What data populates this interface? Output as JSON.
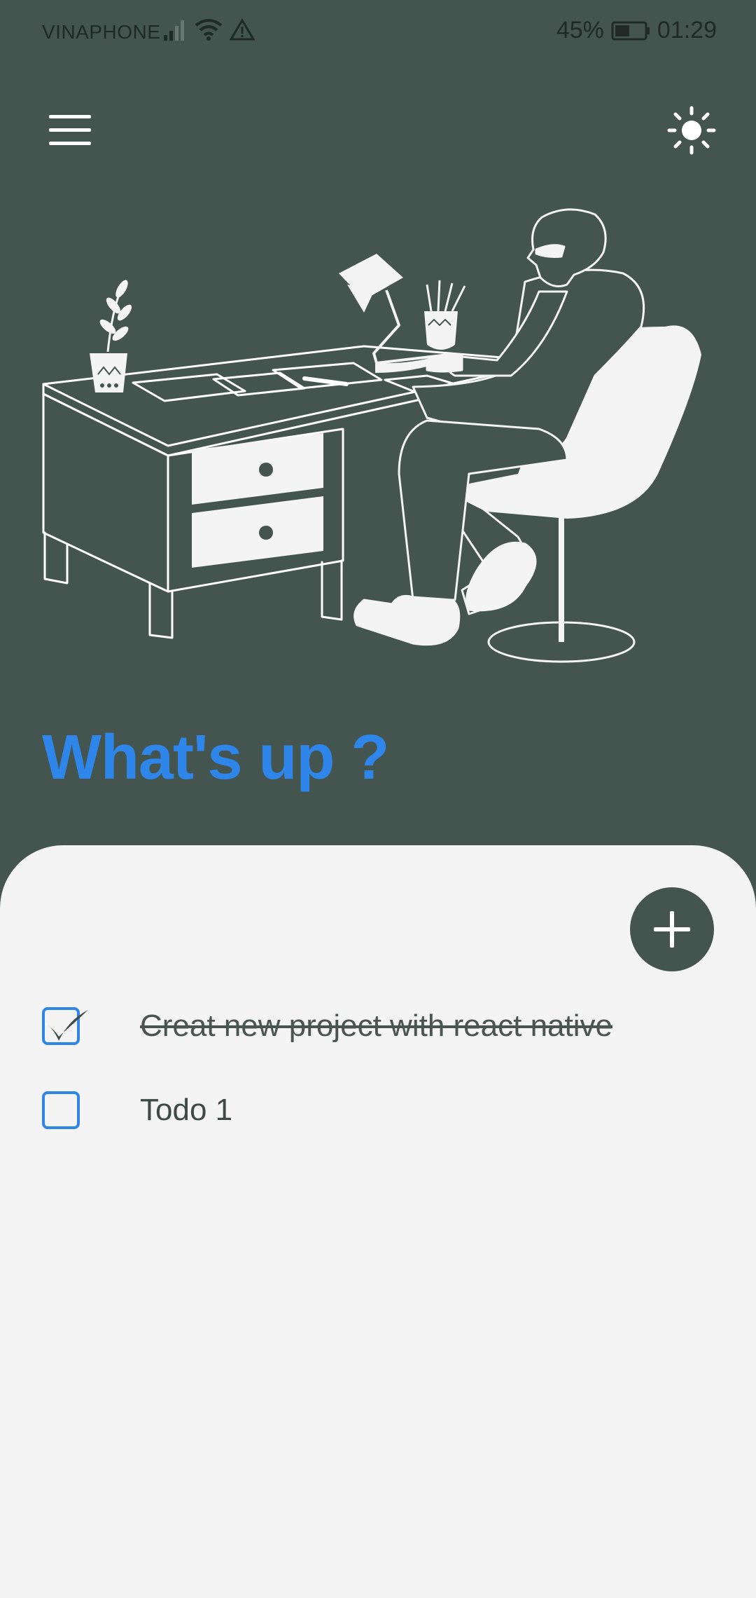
{
  "status_bar": {
    "carrier": "VINAPHONE",
    "battery": "45%",
    "time": "01:29",
    "icons": [
      "signal-icon",
      "wifi-icon",
      "warning-icon",
      "battery-icon"
    ]
  },
  "header": {
    "menu_icon": "hamburger-menu-icon",
    "theme_icon": "sun-icon"
  },
  "hero": {
    "illustration": "person-at-desk-illustration"
  },
  "headline": "What's up ?",
  "todos": [
    {
      "text": "Creat new project with react native",
      "done": true
    },
    {
      "text": "Todo 1",
      "done": false
    }
  ],
  "colors": {
    "background": "#44544f",
    "accent": "#2f86ea",
    "sheet": "#f4f4f4"
  }
}
